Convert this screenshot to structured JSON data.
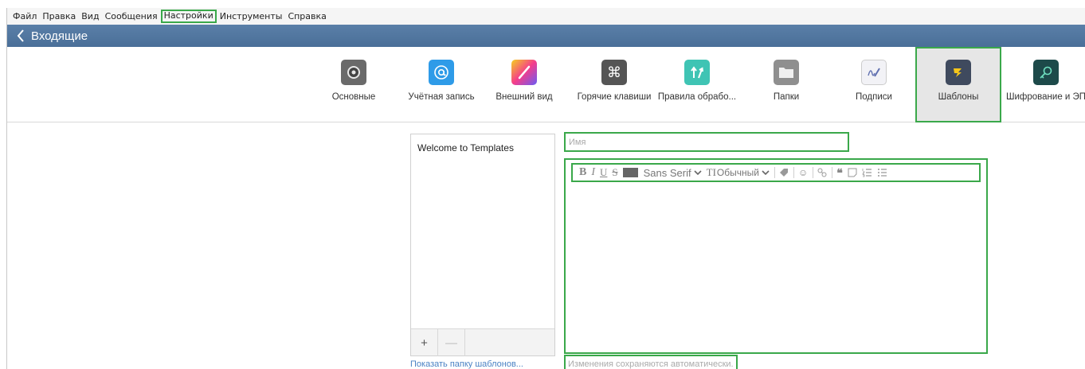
{
  "menubar": {
    "items": [
      "Файл",
      "Правка",
      "Вид",
      "Сообщения",
      "Настройки",
      "Инструменты",
      "Справка"
    ]
  },
  "titlebar": {
    "title": "Входящие",
    "back_icon": "chevron-left-icon"
  },
  "prefs": {
    "tabs": [
      {
        "label": "Основные",
        "icon": "gear-icon",
        "color": "#6a6a6a"
      },
      {
        "label": "Учётная запись",
        "icon": "at-sign-icon",
        "color": "#2e9be8"
      },
      {
        "label": "Внешний вид",
        "icon": "brush-icon",
        "color": "#d94fd0"
      },
      {
        "label": "Горячие клавиши",
        "icon": "command-key-icon",
        "color": "#555555"
      },
      {
        "label": "Правила обрабо...",
        "icon": "arrows-up-icon",
        "color": "#3fc4b4"
      },
      {
        "label": "Папки",
        "icon": "folder-icon",
        "color": "#8f8f8f"
      },
      {
        "label": "Подписи",
        "icon": "signature-icon",
        "color": "#e8e8ee"
      },
      {
        "label": "Шаблоны",
        "icon": "template-arrow-icon",
        "color": "#3f4a5e",
        "active": true
      },
      {
        "label": "Шифрование и ЭП",
        "icon": "key-icon",
        "color": "#1d4a4a"
      }
    ]
  },
  "templates": {
    "items": [
      "Welcome to Templates"
    ],
    "add_label": "+",
    "remove_label": "—",
    "show_folder_link": "Показать папку шаблонов..."
  },
  "editor": {
    "name_placeholder": "Имя",
    "font_family": "Sans Serif",
    "font_size_label": "Обычный",
    "autosave_note": "Изменения сохраняются автоматически."
  },
  "colors": {
    "highlight": "#3aa84a",
    "titlebar": "#4f74a0",
    "link": "#4a82c4"
  }
}
